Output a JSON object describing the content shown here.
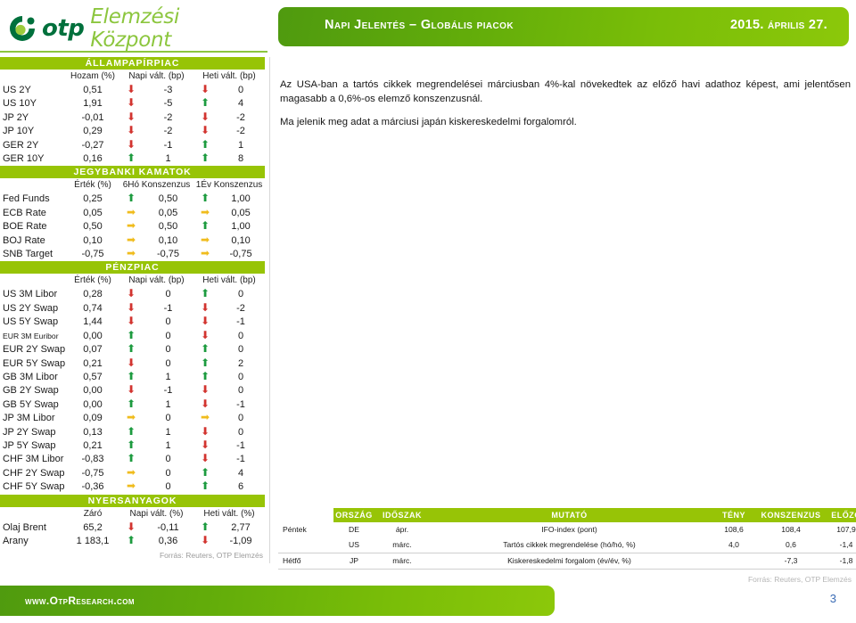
{
  "header": {
    "logo_brand": "otp",
    "logo_sub": "Elemzési Központ",
    "logo_icon": "otp-circle-logo",
    "banner_title": "Napi Jelentés – Globális piacok",
    "banner_date": "2015. április 27."
  },
  "commentary": {
    "paragraph1": "Az USA-ban a tartós cikkek megrendelései márciusban 4%-kal növekedtek az előző havi adathoz képest, ami jelentősen magasabb a 0,6%-os elemző konszenzusnál.",
    "paragraph2": "Ma jelenik meg adat a márciusi japán kiskereskedelmi forgalomról."
  },
  "tables": [
    {
      "title": "ÁLLAMPAPÍRPIAC",
      "columns": [
        "",
        "Hozam (%)",
        "Napi vált. (bp)",
        "Heti vált. (bp)"
      ],
      "rows": [
        {
          "label": "US 2Y",
          "value": "0,51",
          "daily_dir": "down",
          "daily": "-3",
          "weekly_dir": "down",
          "weekly": "0"
        },
        {
          "label": "US 10Y",
          "value": "1,91",
          "daily_dir": "down",
          "daily": "-5",
          "weekly_dir": "up",
          "weekly": "4"
        },
        {
          "label": "JP 2Y",
          "value": "-0,01",
          "daily_dir": "down",
          "daily": "-2",
          "weekly_dir": "down",
          "weekly": "-2"
        },
        {
          "label": "JP 10Y",
          "value": "0,29",
          "daily_dir": "down",
          "daily": "-2",
          "weekly_dir": "down",
          "weekly": "-2"
        },
        {
          "label": "GER 2Y",
          "value": "-0,27",
          "daily_dir": "down",
          "daily": "-1",
          "weekly_dir": "up",
          "weekly": "1"
        },
        {
          "label": "GER 10Y",
          "value": "0,16",
          "daily_dir": "up",
          "daily": "1",
          "weekly_dir": "up",
          "weekly": "8"
        }
      ]
    },
    {
      "title": "JEGYBANKI KAMATOK",
      "columns": [
        "",
        "Érték (%)",
        "6Hó Konszenzus",
        "1Év Konszenzus"
      ],
      "rows": [
        {
          "label": "Fed Funds",
          "value": "0,25",
          "daily_dir": "up",
          "daily": "0,50",
          "weekly_dir": "up",
          "weekly": "1,00"
        },
        {
          "label": "ECB Rate",
          "value": "0,05",
          "daily_dir": "flat",
          "daily": "0,05",
          "weekly_dir": "flat",
          "weekly": "0,05"
        },
        {
          "label": "BOE Rate",
          "value": "0,50",
          "daily_dir": "flat",
          "daily": "0,50",
          "weekly_dir": "up",
          "weekly": "1,00"
        },
        {
          "label": "BOJ Rate",
          "value": "0,10",
          "daily_dir": "flat",
          "daily": "0,10",
          "weekly_dir": "flat",
          "weekly": "0,10"
        },
        {
          "label": "SNB Target",
          "value": "-0,75",
          "daily_dir": "flat",
          "daily": "-0,75",
          "weekly_dir": "flat",
          "weekly": "-0,75"
        }
      ]
    },
    {
      "title": "PÉNZPIAC",
      "columns": [
        "",
        "Érték (%)",
        "Napi vált. (bp)",
        "Heti vált. (bp)"
      ],
      "rows": [
        {
          "label": "US 3M Libor",
          "value": "0,28",
          "daily_dir": "down",
          "daily": "0",
          "weekly_dir": "up",
          "weekly": "0"
        },
        {
          "label": "US 2Y Swap",
          "value": "0,74",
          "daily_dir": "down",
          "daily": "-1",
          "weekly_dir": "down",
          "weekly": "-2"
        },
        {
          "label": "US 5Y Swap",
          "value": "1,44",
          "daily_dir": "down",
          "daily": "0",
          "weekly_dir": "down",
          "weekly": "-1"
        },
        {
          "label": "EUR 3M Euribor",
          "small": true,
          "value": "0,00",
          "daily_dir": "up",
          "daily": "0",
          "weekly_dir": "down",
          "weekly": "0"
        },
        {
          "label": "EUR 2Y Swap",
          "value": "0,07",
          "daily_dir": "up",
          "daily": "0",
          "weekly_dir": "up",
          "weekly": "0"
        },
        {
          "label": "EUR 5Y Swap",
          "value": "0,21",
          "daily_dir": "down",
          "daily": "0",
          "weekly_dir": "up",
          "weekly": "2"
        },
        {
          "label": "GB 3M Libor",
          "value": "0,57",
          "daily_dir": "up",
          "daily": "1",
          "weekly_dir": "up",
          "weekly": "0"
        },
        {
          "label": "GB 2Y Swap",
          "value": "0,00",
          "daily_dir": "down",
          "daily": "-1",
          "weekly_dir": "down",
          "weekly": "0"
        },
        {
          "label": "GB 5Y Swap",
          "value": "0,00",
          "daily_dir": "up",
          "daily": "1",
          "weekly_dir": "down",
          "weekly": "-1"
        },
        {
          "label": "JP 3M Libor",
          "value": "0,09",
          "daily_dir": "flat",
          "daily": "0",
          "weekly_dir": "flat",
          "weekly": "0"
        },
        {
          "label": "JP 2Y Swap",
          "value": "0,13",
          "daily_dir": "up",
          "daily": "1",
          "weekly_dir": "down",
          "weekly": "0"
        },
        {
          "label": "JP 5Y Swap",
          "value": "0,21",
          "daily_dir": "up",
          "daily": "1",
          "weekly_dir": "down",
          "weekly": "-1"
        },
        {
          "label": "CHF 3M Libor",
          "value": "-0,83",
          "daily_dir": "up",
          "daily": "0",
          "weekly_dir": "down",
          "weekly": "-1"
        },
        {
          "label": "CHF 2Y Swap",
          "value": "-0,75",
          "daily_dir": "flat",
          "daily": "0",
          "weekly_dir": "up",
          "weekly": "4"
        },
        {
          "label": "CHF 5Y Swap",
          "value": "-0,36",
          "daily_dir": "flat",
          "daily": "0",
          "weekly_dir": "up",
          "weekly": "6"
        }
      ]
    },
    {
      "title": "NYERSANYAGOK",
      "columns": [
        "",
        "Záró",
        "Napi vált. (%)",
        "Heti vált. (%)"
      ],
      "rows": [
        {
          "label": "Olaj Brent",
          "value": "65,2",
          "daily_dir": "down",
          "daily": "-0,11",
          "weekly_dir": "up",
          "weekly": "2,77"
        },
        {
          "label": "Arany",
          "value": "1 183,1",
          "daily_dir": "up",
          "daily": "0,36",
          "weekly_dir": "down",
          "weekly": "-1,09"
        }
      ]
    }
  ],
  "source_left": "Forrás: Reuters, OTP Elemzés",
  "source_right": "Forrás: Reuters, OTP Elemzés",
  "calendar": {
    "columns": [
      "",
      "ORSZÁG",
      "IDŐSZAK",
      "MUTATÓ",
      "TÉNY",
      "KONSZENZUS",
      "ELŐZŐ"
    ],
    "rows": [
      {
        "day": "Péntek",
        "country": "DE",
        "period": "ápr.",
        "indicator": "IFO-index (pont)",
        "actual": "108,6",
        "consensus": "108,4",
        "previous": "107,9"
      },
      {
        "day": "",
        "country": "US",
        "period": "márc.",
        "indicator": "Tartós cikkek megrendelése (hó/hó, %)",
        "actual": "4,0",
        "consensus": "0,6",
        "previous": "-1,4"
      },
      {
        "day": "Hétfő",
        "country": "JP",
        "period": "márc.",
        "indicator": "Kiskereskedelmi forgalom (év/év, %)",
        "actual": "",
        "consensus": "-7,3",
        "previous": "-1,8"
      }
    ]
  },
  "footer": {
    "url": "www.OtpResearch.com",
    "page": "3"
  },
  "colors": {
    "accent_green": "#97c406",
    "banner_green_dark": "#4f9a0f",
    "banner_green_light": "#8cc80a",
    "up": "#1d9b3f",
    "down": "#d2342f",
    "flat": "#f0bc1d",
    "logo_dark": "#00703c",
    "logo_light": "#8cc63e"
  }
}
